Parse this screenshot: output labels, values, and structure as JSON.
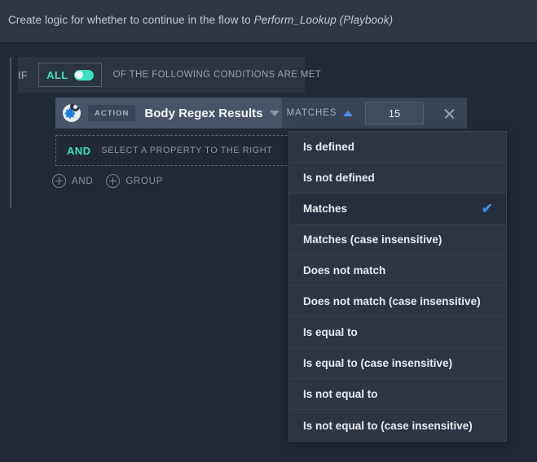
{
  "header": {
    "text_prefix": "Create logic for whether to continue in the flow to ",
    "emphasis": "Perform_Lookup (Playbook)"
  },
  "logic": {
    "if_label": "IF",
    "match_mode": "ALL",
    "conditions_met_text": "OF THE FOLLOWING CONDITIONS ARE MET",
    "toggle_state": "on"
  },
  "condition": {
    "source_icon": "action-gear-icon",
    "badge": "ACTION",
    "property": "Body Regex Results",
    "property_caret_icon": "chevron-down-icon",
    "operator": "MATCHES",
    "operator_caret_icon": "chevron-up-icon",
    "value": "15",
    "remove_icon": "close-icon"
  },
  "placeholder_row": {
    "keyword": "AND",
    "hint": "SELECT A PROPERTY TO THE RIGHT"
  },
  "add_buttons": [
    {
      "icon": "plus-circle-icon",
      "label": "AND"
    },
    {
      "icon": "plus-circle-icon",
      "label": "GROUP"
    }
  ],
  "dropdown": {
    "selected": "Matches",
    "check_icon": "check-icon",
    "items": [
      {
        "label": "Is defined",
        "selected": false
      },
      {
        "label": "Is not defined",
        "selected": false
      },
      {
        "label": "Matches",
        "selected": true
      },
      {
        "label": "Matches (case insensitive)",
        "selected": false
      },
      {
        "label": "Does not match",
        "selected": false
      },
      {
        "label": "Does not match (case insensitive)",
        "selected": false
      },
      {
        "label": "Is equal to",
        "selected": false
      },
      {
        "label": "Is equal to (case insensitive)",
        "selected": false
      },
      {
        "label": "Is not equal to",
        "selected": false
      },
      {
        "label": "Is not equal to (case insensitive)",
        "selected": false
      }
    ]
  },
  "colors": {
    "page_bg": "#222936",
    "header_bg": "#2f3646",
    "row_bg": "#2c3342",
    "chip_bg": "#49546b",
    "operator_bg": "#3a4256",
    "accent_teal": "#3ae0c0",
    "accent_blue": "#4a90e2",
    "dropdown_bg": "#2d3444",
    "dropdown_selected_bg": "#262d3c"
  }
}
